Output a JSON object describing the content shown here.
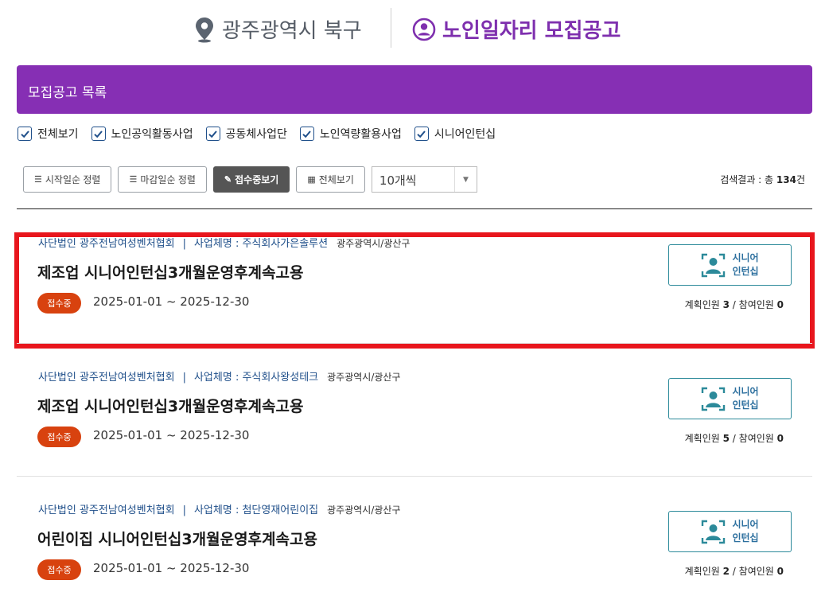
{
  "header": {
    "region": "광주광역시 북구",
    "title": "노인일자리 모집공고",
    "region_icon": "map-pin-icon",
    "title_icon": "person-circle-icon",
    "brand_color": "#7e2fae"
  },
  "list_bar": {
    "title": "모집공고 목록",
    "color": "#862fb4"
  },
  "filters": [
    {
      "label": "전체보기",
      "checked": true
    },
    {
      "label": "노인공익활동사업",
      "checked": true
    },
    {
      "label": "공동체사업단",
      "checked": true
    },
    {
      "label": "노인역량활용사업",
      "checked": true
    },
    {
      "label": "시니어인턴십",
      "checked": true
    }
  ],
  "toolbar": {
    "sort_start": "시작일순 정렬",
    "sort_end": "마감일순 정렬",
    "receiving": "접수중보기",
    "view_all": "전체보기",
    "per_page": "10개씩"
  },
  "result": {
    "prefix": "검색결과 : 총 ",
    "count": "134",
    "suffix": "건"
  },
  "cards": [
    {
      "org": "사단법인 광주전남여성벤처협회",
      "separator": "|",
      "company": "사업체명 : 주식회사가은솔루션",
      "location": "광주광역시/광산구",
      "title": "제조업 시니어인턴십3개월운영후계속고용",
      "status": "접수중",
      "dates": "2025-01-01 ~ 2025-12-30",
      "badge_line1": "시니어",
      "badge_line2": "인턴십",
      "planned_label": "계획인원 ",
      "planned": "3",
      "joined_label": " / 참여인원 ",
      "joined": "0"
    },
    {
      "org": "사단법인 광주전남여성벤처협회",
      "separator": "|",
      "company": "사업체명 : 주식회사왕성테크",
      "location": "광주광역시/광산구",
      "title": "제조업 시니어인턴십3개월운영후계속고용",
      "status": "접수중",
      "dates": "2025-01-01 ~ 2025-12-30",
      "badge_line1": "시니어",
      "badge_line2": "인턴십",
      "planned_label": "계획인원 ",
      "planned": "5",
      "joined_label": " / 참여인원 ",
      "joined": "0"
    },
    {
      "org": "사단법인 광주전남여성벤처협회",
      "separator": "|",
      "company": "사업체명 : 첨단영재어린이집",
      "location": "광주광역시/광산구",
      "title": "어린이집 시니어인턴십3개월운영후계속고용",
      "status": "접수중",
      "dates": "2025-01-01 ~ 2025-12-30",
      "badge_line1": "시니어",
      "badge_line2": "인턴십",
      "planned_label": "계획인원 ",
      "planned": "2",
      "joined_label": " / 참여인원 ",
      "joined": "0"
    }
  ],
  "status_color": "#d8420f",
  "highlight_color": "#e8161d"
}
